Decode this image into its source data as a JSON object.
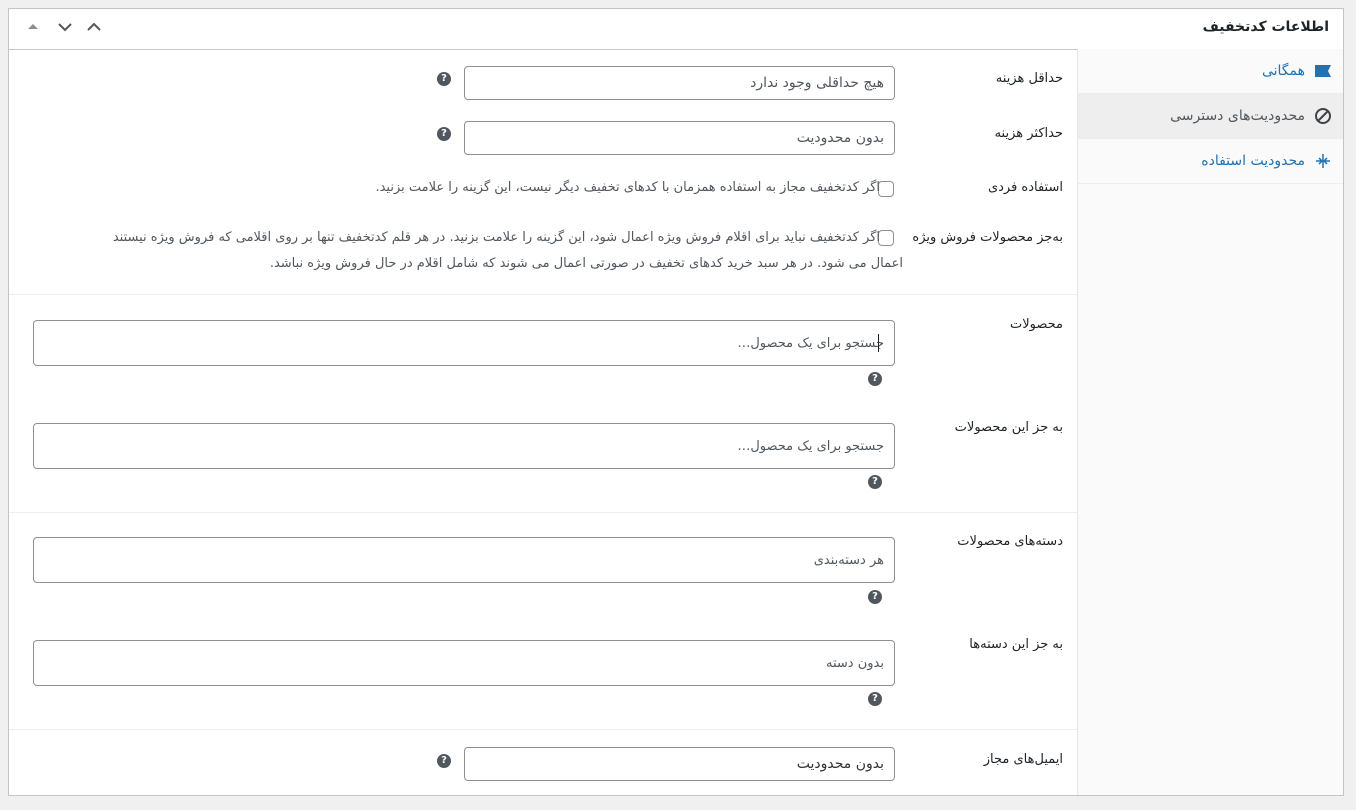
{
  "header": {
    "title": "اطلاعات کدتخفیف"
  },
  "tabs": [
    {
      "label": "همگانی",
      "icon": "ticket-icon"
    },
    {
      "label": "محدودیت‌های دسترسی",
      "icon": "restriction-icon"
    },
    {
      "label": "محدودیت استفاده",
      "icon": "usage-limit-icon"
    }
  ],
  "fields": {
    "minimum_spend": {
      "label": "حداقل هزینه",
      "placeholder": "هیچ حداقلی وجود ندارد"
    },
    "maximum_spend": {
      "label": "حداکثر هزینه",
      "placeholder": "بدون محدودیت"
    },
    "individual_use": {
      "label": "استفاده فردی",
      "description": "اگر کدتخفیف مجاز به استفاده همزمان با کدهای تخفیف دیگر نیست، این گزینه را علامت بزنید."
    },
    "exclude_sale": {
      "label": "به‌جز محصولات فروش ویژه",
      "description_line1": "اگر کدتخفیف نباید برای اقلام فروش ویژه اعمال شود، این گزینه را علامت بزنید. در هر قلم کدتخفیف تنها بر روی اقلامی که فروش ویژه نیستند",
      "description_line2": "اعمال می شود. در هر سبد خرید کدهای تخفیف در صورتی اعمال می شوند که شامل اقلام در حال فروش ویژه نباشد."
    },
    "products": {
      "label": "محصولات",
      "placeholder": "جستجو برای یک محصول…"
    },
    "exclude_products": {
      "label": "به جز این محصولات",
      "placeholder": "جستجو برای یک محصول…"
    },
    "categories": {
      "label": "دسته‌های محصولات",
      "placeholder": "هر دسته‌بندی"
    },
    "exclude_categories": {
      "label": "به جز این دسته‌ها",
      "placeholder": "بدون دسته"
    },
    "allowed_emails": {
      "label": "ایمیل‌های مجاز",
      "placeholder": "بدون محدودیت"
    }
  },
  "help_glyph": "?",
  "colors": {
    "link": "#2271b1",
    "border": "#8c8f94",
    "active_tab_bg": "#eeeeee"
  }
}
